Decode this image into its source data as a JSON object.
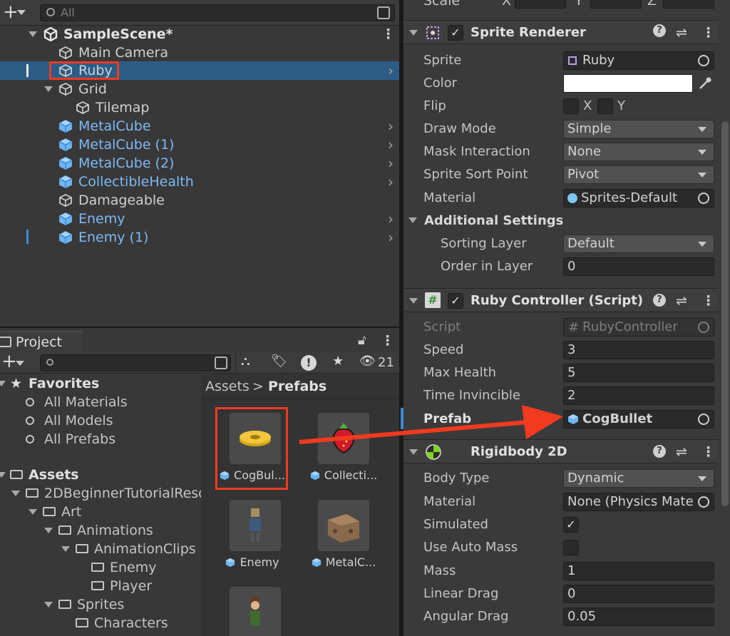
{
  "hierarchy": {
    "search_placeholder": "All",
    "scene": "SampleScene*",
    "items": [
      {
        "label": "Main Camera",
        "blue": false
      },
      {
        "label": "Ruby",
        "blue": false
      },
      {
        "label": "Grid",
        "blue": false
      },
      {
        "label": "Tilemap",
        "blue": false
      },
      {
        "label": "MetalCube",
        "blue": true
      },
      {
        "label": "MetalCube (1)",
        "blue": true
      },
      {
        "label": "MetalCube (2)",
        "blue": true
      },
      {
        "label": "CollectibleHealth",
        "blue": true
      },
      {
        "label": "Damageable",
        "blue": false
      },
      {
        "label": "Enemy",
        "blue": true
      },
      {
        "label": "Enemy (1)",
        "blue": true
      }
    ]
  },
  "inspector": {
    "top_label": "Scale",
    "top_axes": [
      "X",
      "Y",
      "Z"
    ],
    "sprite_renderer": {
      "title": "Sprite Renderer",
      "props": {
        "sprite_label": "Sprite",
        "sprite_value": "Ruby",
        "color_label": "Color",
        "flip_label": "Flip",
        "flip_x": "X",
        "flip_y": "Y",
        "draw_mode_label": "Draw Mode",
        "draw_mode_value": "Simple",
        "mask_label": "Mask Interaction",
        "mask_value": "None",
        "sort_point_label": "Sprite Sort Point",
        "sort_point_value": "Pivot",
        "material_label": "Material",
        "material_value": "Sprites-Default",
        "additional_label": "Additional Settings",
        "sorting_layer_label": "Sorting Layer",
        "sorting_layer_value": "Default",
        "order_label": "Order in Layer",
        "order_value": "0"
      }
    },
    "ruby_controller": {
      "title": "Ruby Controller (Script)",
      "props": {
        "script_label": "Script",
        "script_value": "RubyController",
        "speed_label": "Speed",
        "speed_value": "3",
        "max_health_label": "Max Health",
        "max_health_value": "5",
        "time_inv_label": "Time Invincible",
        "time_inv_value": "2",
        "prefab_label": "Prefab",
        "prefab_value": "CogBullet"
      }
    },
    "rigidbody": {
      "title": "Rigidbody 2D",
      "props": {
        "body_type_label": "Body Type",
        "body_type_value": "Dynamic",
        "material_label": "Material",
        "material_value": "None (Physics Mate",
        "simulated_label": "Simulated",
        "auto_mass_label": "Use Auto Mass",
        "mass_label": "Mass",
        "mass_value": "1",
        "linear_drag_label": "Linear Drag",
        "linear_drag_value": "0",
        "angular_drag_label": "Angular Drag",
        "angular_drag_value": "0.05"
      }
    }
  },
  "project": {
    "tab": "Project",
    "count": "21",
    "breadcrumb_root": "Assets",
    "breadcrumb_sep": ">",
    "breadcrumb_current": "Prefabs",
    "tree": {
      "favorites": "Favorites",
      "fav_items": [
        "All Materials",
        "All Models",
        "All Prefabs"
      ],
      "assets": "Assets",
      "folders": [
        "2DBeginnerTutorialReso",
        "Art",
        "Animations",
        "AnimationClips",
        "Enemy",
        "Player",
        "Sprites",
        "Characters"
      ]
    },
    "assets": [
      "CogBul...",
      "Collecti...",
      "Enemy",
      "MetalC..."
    ]
  },
  "colors": {
    "accent_red": "#f23a1f",
    "selection": "#2c5d87",
    "prefab_blue": "#7ebaf7"
  }
}
